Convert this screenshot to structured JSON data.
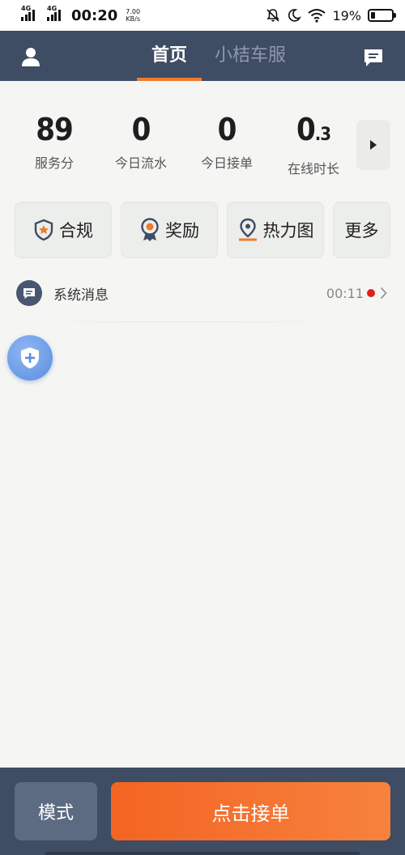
{
  "status_bar": {
    "network1": "4G",
    "network2": "4G",
    "time": "00:20",
    "speed_value": "7.00",
    "speed_unit": "KB/s",
    "battery_percent": "19%",
    "battery_level": 0.19
  },
  "header": {
    "tabs": [
      {
        "label": "首页",
        "active": true
      },
      {
        "label": "小桔车服",
        "active": false
      }
    ],
    "user_icon": "user-icon",
    "message_icon": "chat-bubble-icon"
  },
  "stats": [
    {
      "value": "89",
      "label": "服务分"
    },
    {
      "value": "0",
      "label": "今日流水"
    },
    {
      "value": "0",
      "label": "今日接单"
    },
    {
      "value_main": "0",
      "value_decimal": ".3",
      "label": "在线时长"
    }
  ],
  "quick_actions": [
    {
      "label": "合规",
      "icon": "shield-star-icon"
    },
    {
      "label": "奖励",
      "icon": "medal-icon"
    },
    {
      "label": "热力图",
      "icon": "map-pin-icon"
    },
    {
      "label": "更多",
      "icon": ""
    }
  ],
  "message": {
    "label": "系统消息",
    "time": "00:11",
    "icon": "message-icon"
  },
  "bottom": {
    "mode_label": "模式",
    "go_label": "点击接单"
  },
  "colors": {
    "header_bg": "#3e4c64",
    "accent_orange": "#f46422",
    "tab_indicator": "#f07a2c",
    "unread_dot": "#e0201a"
  }
}
